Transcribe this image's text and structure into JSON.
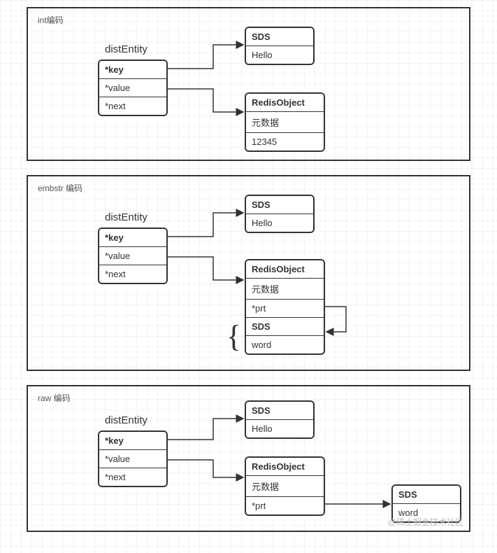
{
  "panels": [
    {
      "label": "int编码",
      "entityTitle": "distEntity",
      "entityRows": [
        "*key",
        "*value",
        "*next"
      ],
      "sds": {
        "header": "SDS",
        "value": "Hello"
      },
      "obj": {
        "header": "RedisObject",
        "rows": [
          "元数据",
          "12345"
        ]
      }
    },
    {
      "label": "embstr 编码",
      "entityTitle": "distEntity",
      "entityRows": [
        "*key",
        "*value",
        "*next"
      ],
      "sds": {
        "header": "SDS",
        "value": "Hello"
      },
      "obj": {
        "header": "RedisObject",
        "rows": [
          "元数据",
          "*prt",
          "SDS",
          "word"
        ]
      },
      "boldIdx": 3
    },
    {
      "label": "raw 编码",
      "entityTitle": "distEntity",
      "entityRows": [
        "*key",
        "*value",
        "*next"
      ],
      "sds": {
        "header": "SDS",
        "value": "Hello"
      },
      "obj": {
        "header": "RedisObject",
        "rows": [
          "元数据",
          "*prt"
        ]
      },
      "extSds": {
        "header": "SDS",
        "value": "word"
      }
    }
  ],
  "watermark": "@稀土掘金技术社区"
}
